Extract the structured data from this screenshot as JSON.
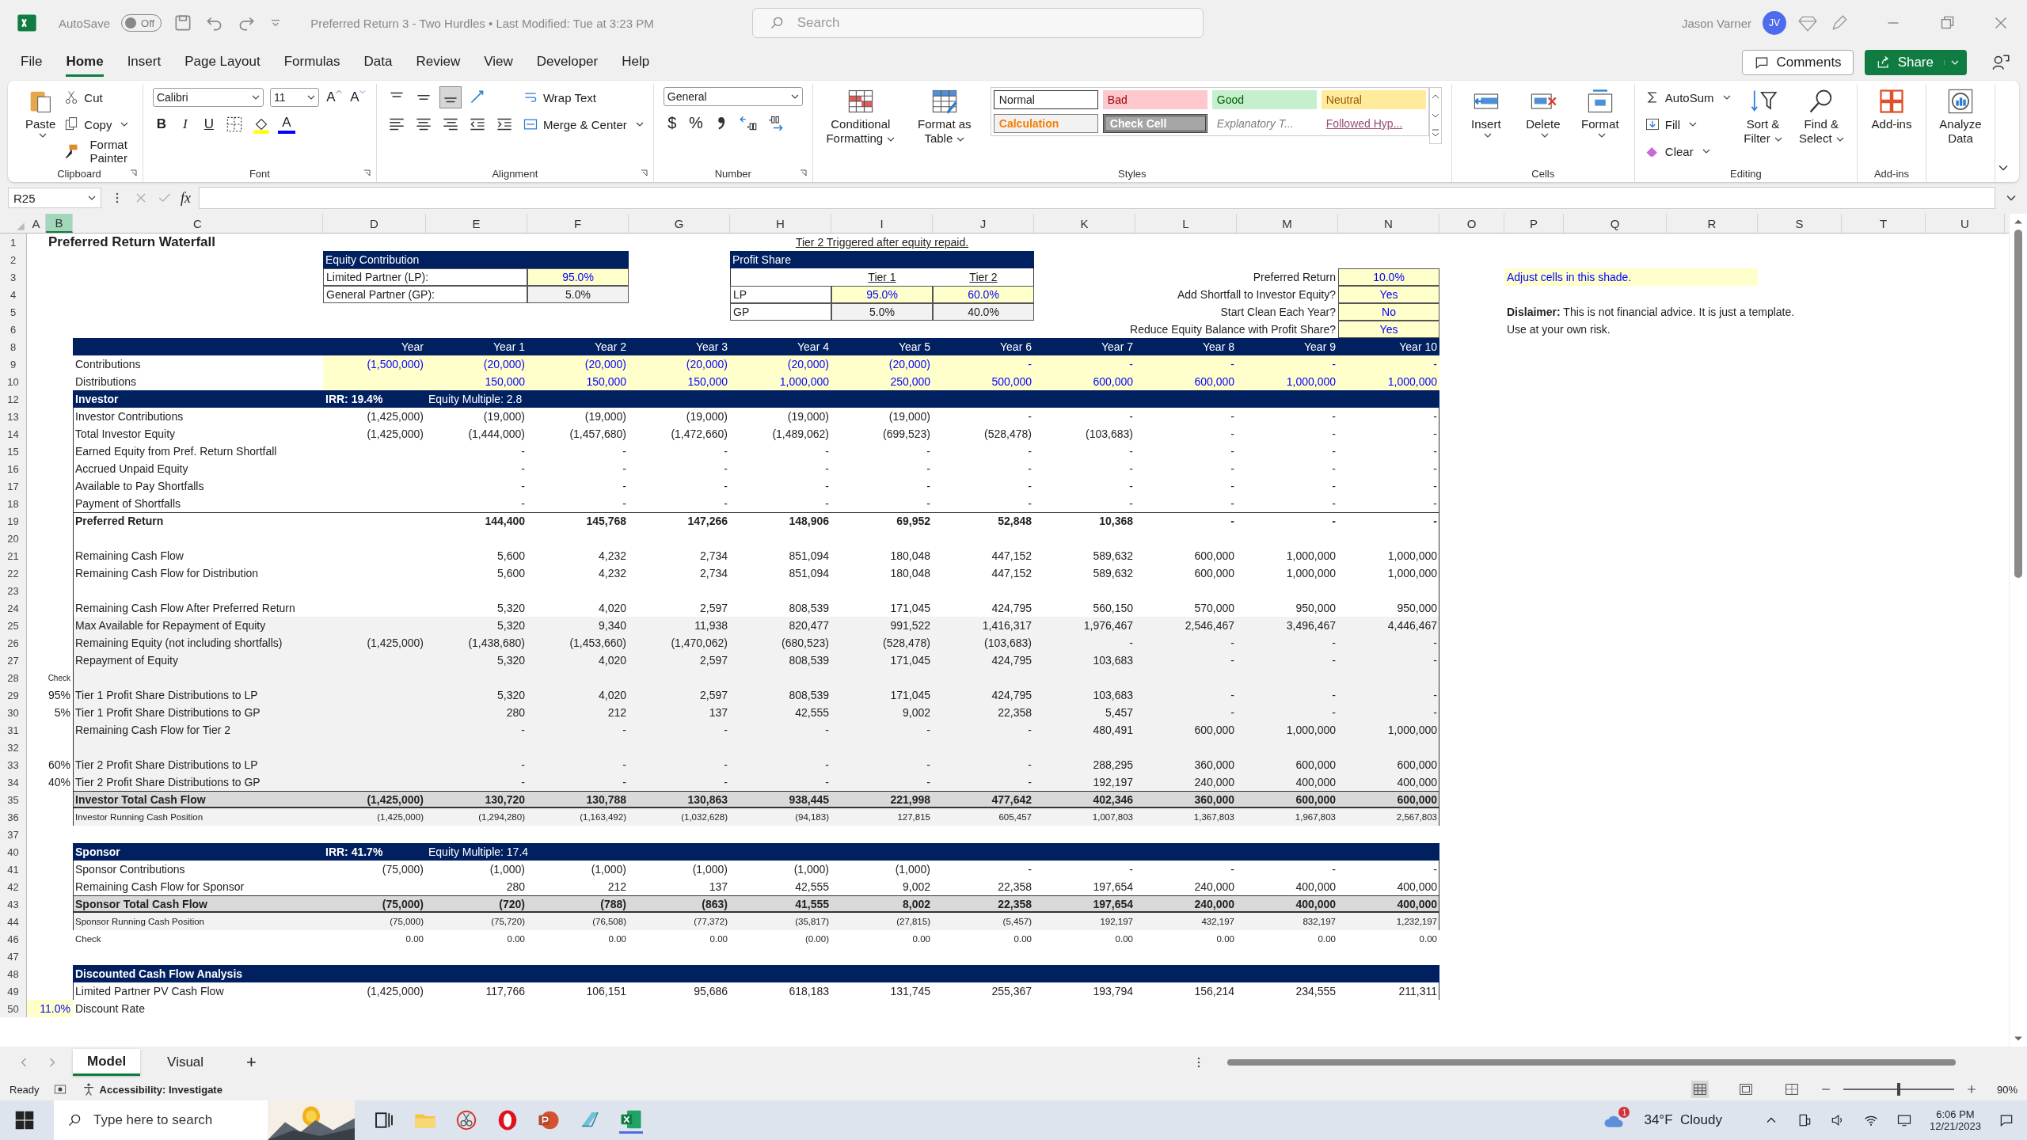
{
  "title_bar": {
    "autosave": "AutoSave",
    "autosave_state": {
      "label": "Off",
      "on": false
    },
    "document": "Preferred Return 3 - Two Hurdles • Last Modified: Tue at 3:23 PM",
    "search": {
      "placeholder": "Search"
    },
    "user": "Jason Varner",
    "avatar": "JV"
  },
  "menu": {
    "tabs": [
      {
        "label": "File",
        "selected": false
      },
      {
        "label": "Home",
        "selected": true
      },
      {
        "label": "Insert",
        "selected": false
      },
      {
        "label": "Page Layout",
        "selected": false
      },
      {
        "label": "Formulas",
        "selected": false
      },
      {
        "label": "Data",
        "selected": false
      },
      {
        "label": "Review",
        "selected": false
      },
      {
        "label": "View",
        "selected": false
      },
      {
        "label": "Developer",
        "selected": false
      },
      {
        "label": "Help",
        "selected": false
      }
    ],
    "comments": "Comments",
    "share": "Share"
  },
  "ribbon": {
    "clipboard": {
      "label": "Clipboard",
      "paste": "Paste",
      "cut": "Cut",
      "copy": "Copy",
      "format_painter": "Format Painter"
    },
    "font": {
      "label": "Font",
      "family": "Calibri",
      "size": "11",
      "grow": "A",
      "shrink": "A",
      "bold": "B",
      "italic": "I",
      "underline": "U",
      "tint": "A"
    },
    "alignment": {
      "label": "Alignment",
      "vertical": [
        {
          "selected": false
        },
        {
          "selected": false
        },
        {
          "selected": true
        }
      ],
      "wrap": "Wrap Text",
      "merge": "Merge & Center"
    },
    "number": {
      "label": "Number",
      "format": "General",
      "currency": "$",
      "percent": "%"
    },
    "styles": {
      "label": "Styles",
      "conditional": "Conditional Formatting",
      "table": "Format as Table",
      "gallery": [
        {
          "text": "Normal",
          "kind": "normal"
        },
        {
          "text": "Bad",
          "kind": "bad"
        },
        {
          "text": "Good",
          "kind": "good"
        },
        {
          "text": "Neutral",
          "kind": "neutral"
        },
        {
          "text": "Calculation",
          "kind": "calculation"
        },
        {
          "text": "Check Cell",
          "kind": "check"
        },
        {
          "text": "Explanatory T...",
          "kind": "explanatory"
        },
        {
          "text": "Followed Hyp...",
          "kind": "followed"
        }
      ]
    },
    "cells": {
      "label": "Cells",
      "insert": "Insert",
      "delete": "Delete",
      "format": "Format"
    },
    "editing": {
      "label": "Editing",
      "autosum": "AutoSum",
      "fill": "Fill",
      "clear": "Clear",
      "sort": "Sort & Filter",
      "find": "Find & Select"
    },
    "addins": {
      "label": "Add-ins",
      "button": "Add-ins"
    },
    "analyze": "Analyze Data"
  },
  "formula_bar": {
    "name_box": "R25",
    "fx": "fx"
  },
  "sheet": {
    "columns": [
      {
        "label": "A",
        "selected": false
      },
      {
        "label": "B",
        "selected": true
      },
      {
        "label": "C",
        "selected": false
      },
      {
        "label": "D",
        "selected": false
      },
      {
        "label": "E",
        "selected": false
      },
      {
        "label": "F",
        "selected": false
      },
      {
        "label": "G",
        "selected": false
      },
      {
        "label": "H",
        "selected": false
      },
      {
        "label": "I",
        "selected": false
      },
      {
        "label": "J",
        "selected": false
      },
      {
        "label": "K",
        "selected": false
      },
      {
        "label": "L",
        "selected": false
      },
      {
        "label": "M",
        "selected": false
      },
      {
        "label": "N",
        "selected": false
      },
      {
        "label": "O",
        "selected": false
      },
      {
        "label": "P",
        "selected": false
      },
      {
        "label": "Q",
        "selected": false
      },
      {
        "label": "R",
        "selected": false
      },
      {
        "label": "S",
        "selected": false
      },
      {
        "label": "T",
        "selected": false
      },
      {
        "label": "U",
        "selected": false
      }
    ],
    "top_rows": [
      "1",
      "2",
      "3",
      "4",
      "5",
      "6"
    ],
    "title": "Preferred Return Waterfall",
    "equity_contribution": {
      "title": "Equity Contribution",
      "rows": [
        {
          "label": "Limited Partner (LP):",
          "value": "95.0%",
          "kind": "input"
        },
        {
          "label": "General Partner (GP):",
          "value": "5.0%",
          "kind": "fixed"
        }
      ]
    },
    "profit_share": {
      "note": "Tier 2 Triggered after equity repaid.",
      "title": "Profit Share",
      "tiers": [
        "Tier 1",
        "Tier 2"
      ],
      "rows": [
        {
          "label": "LP",
          "values": [
            {
              "text": "95.0%",
              "kind": "input"
            },
            {
              "text": "60.0%",
              "kind": "input"
            }
          ]
        },
        {
          "label": "GP",
          "values": [
            {
              "text": "5.0%",
              "kind": "fixed"
            },
            {
              "text": "40.0%",
              "kind": "fixed"
            }
          ]
        }
      ]
    },
    "settings": [
      {
        "label": "Preferred Return",
        "value": "10.0%"
      },
      {
        "label": "Add Shortfall to Investor Equity?",
        "value": "Yes"
      },
      {
        "label": "Start Clean Each Year?",
        "value": "No"
      },
      {
        "label": "Reduce Equity Balance with Profit Share?",
        "value": "Yes"
      }
    ],
    "legend": "Adjust cells in this shade.",
    "disclaimer": [
      "**Dislaimer:** This is not financial advice. It is just a template.",
      "Use at your own risk."
    ],
    "rows": [
      {
        "number": "8",
        "kind": "band",
        "initial": "Year",
        "values": [
          "Year 1",
          "Year 2",
          "Year 3",
          "Year 4",
          "Year 5",
          "Year 6",
          "Year 7",
          "Year 8",
          "Year 9",
          "Year 10"
        ]
      },
      {
        "number": "9",
        "kind": "input",
        "label": "Contributions",
        "initial": "(1,500,000)",
        "values": [
          "(20,000)",
          "(20,000)",
          "(20,000)",
          "(20,000)",
          "(20,000)",
          "-",
          "-",
          "-",
          "-",
          "-"
        ]
      },
      {
        "number": "10",
        "kind": "input",
        "label": "Distributions",
        "values": [
          "150,000",
          "150,000",
          "150,000",
          "1,000,000",
          "250,000",
          "500,000",
          "600,000",
          "600,000",
          "1,000,000",
          "1,000,000"
        ]
      },
      {
        "number": "12",
        "kind": "section",
        "label": "Investor",
        "initial": "IRR: 19.4%",
        "values": [
          "Equity Multiple: 2.8"
        ]
      },
      {
        "number": "13",
        "kind": "plain",
        "label": "Investor Contributions",
        "initial": "(1,425,000)",
        "values": [
          "(19,000)",
          "(19,000)",
          "(19,000)",
          "(19,000)",
          "(19,000)",
          "-",
          "-",
          "-",
          "-",
          "-"
        ]
      },
      {
        "number": "14",
        "kind": "plain",
        "label": "Total Investor Equity",
        "initial": "(1,425,000)",
        "values": [
          "(1,444,000)",
          "(1,457,680)",
          "(1,472,660)",
          "(1,489,062)",
          "(699,523)",
          "(528,478)",
          "(103,683)",
          "-",
          "-",
          "-"
        ]
      },
      {
        "number": "15",
        "kind": "plain",
        "label": "Earned Equity from Pref. Return Shortfall",
        "values": [
          "-",
          "-",
          "-",
          "-",
          "-",
          "-",
          "-",
          "-",
          "-",
          "-"
        ]
      },
      {
        "number": "16",
        "kind": "plain",
        "label": "Accrued Unpaid Equity",
        "values": [
          "-",
          "-",
          "-",
          "-",
          "-",
          "-",
          "-",
          "-",
          "-",
          "-"
        ]
      },
      {
        "number": "17",
        "kind": "plain",
        "label": "Available to Pay Shortfalls",
        "values": [
          "-",
          "-",
          "-",
          "-",
          "-",
          "-",
          "-",
          "-",
          "-",
          "-"
        ]
      },
      {
        "number": "18",
        "kind": "plain",
        "label": "Payment of Shortfalls",
        "values": [
          "-",
          "-",
          "-",
          "-",
          "-",
          "-",
          "-",
          "-",
          "-",
          "-"
        ]
      },
      {
        "number": "19",
        "kind": "subtotal",
        "label": "Preferred Return",
        "values": [
          "144,400",
          "145,768",
          "147,266",
          "148,906",
          "69,952",
          "52,848",
          "10,368",
          "-",
          "-",
          "-"
        ]
      },
      {
        "number": "20",
        "kind": "gap"
      },
      {
        "number": "21",
        "kind": "plain",
        "label": "Remaining Cash Flow",
        "values": [
          "5,600",
          "4,232",
          "2,734",
          "851,094",
          "180,048",
          "447,152",
          "589,632",
          "600,000",
          "1,000,000",
          "1,000,000"
        ]
      },
      {
        "number": "22",
        "kind": "plain",
        "label": "Remaining Cash Flow for Distribution",
        "values": [
          "5,600",
          "4,232",
          "2,734",
          "851,094",
          "180,048",
          "447,152",
          "589,632",
          "600,000",
          "1,000,000",
          "1,000,000"
        ]
      },
      {
        "number": "23",
        "kind": "gap"
      },
      {
        "number": "24",
        "kind": "plain",
        "label": "Remaining Cash Flow After Preferred Return",
        "values": [
          "5,320",
          "4,020",
          "2,597",
          "808,539",
          "171,045",
          "424,795",
          "560,150",
          "570,000",
          "950,000",
          "950,000"
        ]
      },
      {
        "number": "25",
        "kind": "shaded",
        "label": "Max Available for Repayment of Equity",
        "values": [
          "5,320",
          "9,340",
          "11,938",
          "820,477",
          "991,522",
          "1,416,317",
          "1,976,467",
          "2,546,467",
          "3,496,467",
          "4,446,467"
        ]
      },
      {
        "number": "26",
        "kind": "shaded",
        "label": "Remaining Equity (not including shortfalls)",
        "initial": "(1,425,000)",
        "values": [
          "(1,438,680)",
          "(1,453,660)",
          "(1,470,062)",
          "(680,523)",
          "(528,478)",
          "(103,683)",
          "-",
          "-",
          "-",
          "-"
        ]
      },
      {
        "number": "27",
        "kind": "shaded",
        "label": "Repayment of Equity",
        "values": [
          "5,320",
          "4,020",
          "2,597",
          "808,539",
          "171,045",
          "424,795",
          "103,683",
          "-",
          "-",
          "-"
        ]
      },
      {
        "number": "28",
        "kind": "shaded",
        "marker": "Check"
      },
      {
        "number": "29",
        "kind": "shaded",
        "marker": "95%",
        "label": "Tier 1 Profit Share Distributions to LP",
        "values": [
          "5,320",
          "4,020",
          "2,597",
          "808,539",
          "171,045",
          "424,795",
          "103,683",
          "-",
          "-",
          "-"
        ]
      },
      {
        "number": "30",
        "kind": "shaded",
        "marker": "5%",
        "label": "Tier 1 Profit Share Distributions to GP",
        "values": [
          "280",
          "212",
          "137",
          "42,555",
          "9,002",
          "22,358",
          "5,457",
          "-",
          "-",
          "-"
        ]
      },
      {
        "number": "31",
        "kind": "shaded",
        "label": "Remaining Cash Flow for Tier 2",
        "values": [
          "-",
          "-",
          "-",
          "-",
          "-",
          "-",
          "480,491",
          "600,000",
          "1,000,000",
          "1,000,000"
        ]
      },
      {
        "number": "32",
        "kind": "shaded"
      },
      {
        "number": "33",
        "kind": "shaded",
        "marker": "60%",
        "label": "Tier 2 Profit Share Distributions to LP",
        "values": [
          "-",
          "-",
          "-",
          "-",
          "-",
          "-",
          "288,295",
          "360,000",
          "600,000",
          "600,000"
        ]
      },
      {
        "number": "34",
        "kind": "shaded",
        "marker": "40%",
        "label": "Tier 2 Profit Share Distributions to GP",
        "values": [
          "-",
          "-",
          "-",
          "-",
          "-",
          "-",
          "192,197",
          "240,000",
          "400,000",
          "400,000"
        ]
      },
      {
        "number": "35",
        "kind": "total",
        "label": "Investor Total Cash Flow",
        "initial": "(1,425,000)",
        "values": [
          "130,720",
          "130,788",
          "130,863",
          "938,445",
          "221,998",
          "477,642",
          "402,346",
          "360,000",
          "600,000",
          "600,000"
        ]
      },
      {
        "number": "36",
        "kind": "running",
        "label": "Investor Running Cash Position",
        "initial": "(1,425,000)",
        "values": [
          "(1,294,280)",
          "(1,163,492)",
          "(1,032,628)",
          "(94,183)",
          "127,815",
          "605,457",
          "1,007,803",
          "1,367,803",
          "1,967,803",
          "2,567,803"
        ]
      },
      {
        "number": "37",
        "kind": "space"
      },
      {
        "number": "40",
        "kind": "section",
        "label": "Sponsor",
        "initial": "IRR: 41.7%",
        "values": [
          "Equity Multiple: 17.4"
        ]
      },
      {
        "number": "41",
        "kind": "plain",
        "label": "Sponsor Contributions",
        "initial": "(75,000)",
        "values": [
          "(1,000)",
          "(1,000)",
          "(1,000)",
          "(1,000)",
          "(1,000)",
          "-",
          "-",
          "-",
          "-",
          "-"
        ]
      },
      {
        "number": "42",
        "kind": "plain",
        "label": "Remaining Cash Flow for Sponsor",
        "values": [
          "280",
          "212",
          "137",
          "42,555",
          "9,002",
          "22,358",
          "197,654",
          "240,000",
          "400,000",
          "400,000"
        ]
      },
      {
        "number": "43",
        "kind": "total",
        "label": "Sponsor Total Cash Flow",
        "initial": "(75,000)",
        "values": [
          "(720)",
          "(788)",
          "(863)",
          "41,555",
          "8,002",
          "22,358",
          "197,654",
          "240,000",
          "400,000",
          "400,000"
        ]
      },
      {
        "number": "44",
        "kind": "running",
        "label": "Sponsor Running Cash Position",
        "initial": "(75,000)",
        "values": [
          "(75,720)",
          "(76,508)",
          "(77,372)",
          "(35,817)",
          "(27,815)",
          "(5,457)",
          "192,197",
          "432,197",
          "832,197",
          "1,232,197"
        ]
      },
      {
        "number": "46",
        "kind": "check",
        "label": "Check",
        "initial": "0.00",
        "values": [
          "0.00",
          "0.00",
          "0.00",
          "(0.00)",
          "0.00",
          "0.00",
          "0.00",
          "0.00",
          "0.00",
          "0.00"
        ]
      },
      {
        "number": "47",
        "kind": "space"
      },
      {
        "number": "48",
        "kind": "band",
        "label": "Discounted Cash Flow Analysis"
      },
      {
        "number": "49",
        "kind": "plain",
        "label": "Limited Partner PV Cash Flow",
        "initial": "(1,425,000)",
        "values": [
          "117,766",
          "106,151",
          "95,686",
          "618,183",
          "131,745",
          "255,367",
          "193,794",
          "156,214",
          "234,555",
          "211,311"
        ]
      },
      {
        "number": "50",
        "kind": "rate",
        "marker": "11.0%",
        "label": "Discount Rate"
      }
    ],
    "tabs": [
      {
        "label": "Model",
        "selected": true
      },
      {
        "label": "Visual",
        "selected": false
      }
    ],
    "add_sheet": "+"
  },
  "status_bar": {
    "ready": "Ready",
    "accessibility": "Accessibility: Investigate",
    "views": [
      {
        "selected": true
      },
      {
        "selected": false
      },
      {
        "selected": false
      }
    ],
    "zoom": {
      "level": 0.5,
      "reading": "90%"
    }
  },
  "taskbar": {
    "search": {
      "placeholder": "Type here to search"
    },
    "weather_badge": "1",
    "weather": "34°F  Cloudy",
    "time": "6:06 PM",
    "date": "12/21/2023"
  }
}
